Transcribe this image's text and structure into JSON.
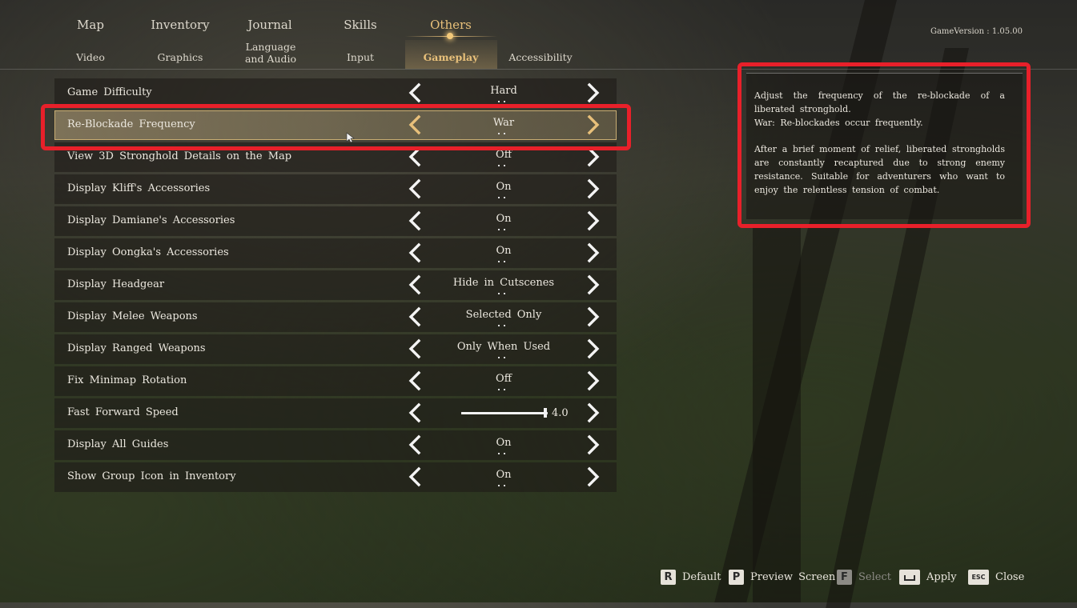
{
  "tabs": {
    "main": [
      "Map",
      "Inventory",
      "Journal",
      "Skills",
      "Others"
    ],
    "active_main": "Others",
    "sub": [
      "Video",
      "Graphics",
      "Language and Audio",
      "Input",
      "Gameplay",
      "Accessibility"
    ],
    "active_sub": "Gameplay"
  },
  "game_version": "GameVersion : 1.05.00",
  "settings": [
    {
      "label": "Game Difficulty",
      "value": "Hard"
    },
    {
      "label": "Re-Blockade Frequency",
      "value": "War",
      "selected": true
    },
    {
      "label": "View 3D Stronghold Details on the Map",
      "value": "Off"
    },
    {
      "label": "Display Kliff's Accessories",
      "value": "On"
    },
    {
      "label": "Display Damiane's Accessories",
      "value": "On"
    },
    {
      "label": "Display Oongka's Accessories",
      "value": "On"
    },
    {
      "label": "Display Headgear",
      "value": "Hide in Cutscenes"
    },
    {
      "label": "Display Melee Weapons",
      "value": "Selected Only"
    },
    {
      "label": "Display Ranged Weapons",
      "value": "Only When Used"
    },
    {
      "label": "Fix Minimap Rotation",
      "value": "Off"
    },
    {
      "label": "Fast Forward Speed",
      "value": "4.0",
      "slider_fraction": 0.97
    },
    {
      "label": "Display All Guides",
      "value": "On"
    },
    {
      "label": "Show Group Icon in Inventory",
      "value": "On"
    }
  ],
  "description": {
    "line1": "Adjust the frequency of the re-blockade of a liberated stronghold.",
    "line2": "War: Re-blockades occur frequently.",
    "line3": "After a brief moment of relief, liberated strongholds are constantly recaptured due to strong enemy resistance. Suitable for adventurers who want to enjoy the relentless tension of combat."
  },
  "footer": {
    "default_key": "R",
    "default_label": "Default",
    "preview_key": "P",
    "preview_label": "Preview Screen",
    "select_key": "F",
    "select_label": "Select",
    "apply_label": "Apply",
    "close_key": "ESC",
    "close_label": "Close"
  },
  "colors": {
    "accent": "#e8c07a",
    "highlight_box": "#e8202a"
  }
}
